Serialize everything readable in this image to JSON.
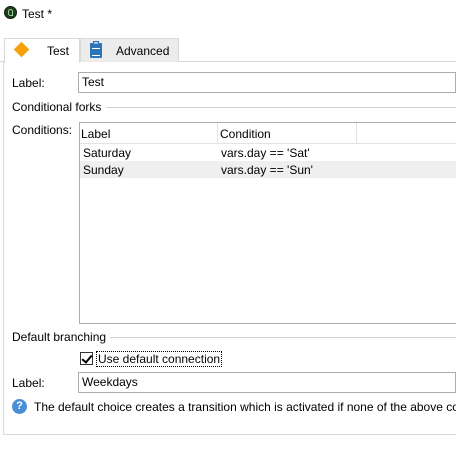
{
  "window": {
    "title": "Test *"
  },
  "tabs": [
    {
      "label": "Test",
      "icon": "diamond-icon"
    },
    {
      "label": "Advanced",
      "icon": "clipboard-icon"
    }
  ],
  "form": {
    "label_caption": "Label:",
    "label_value": "Test",
    "conditional_forks_title": "Conditional forks",
    "conditions_caption": "Conditions:",
    "conditions_table": {
      "columns": [
        "Label",
        "Condition"
      ],
      "rows": [
        {
          "label": "Saturday",
          "condition": "vars.day == 'Sat'"
        },
        {
          "label": "Sunday",
          "condition": "vars.day == 'Sun'"
        }
      ]
    },
    "default_branching_title": "Default branching",
    "use_default_connection_label": "Use default connection",
    "use_default_connection_checked": true,
    "default_label_caption": "Label:",
    "default_label_value": "Weekdays",
    "help_text": "The default choice creates a transition which is activated if none of the above co"
  },
  "colors": {
    "diamond": "#f5a00c",
    "selected_row": "#efefef",
    "help_icon": "#4a8fd6"
  }
}
